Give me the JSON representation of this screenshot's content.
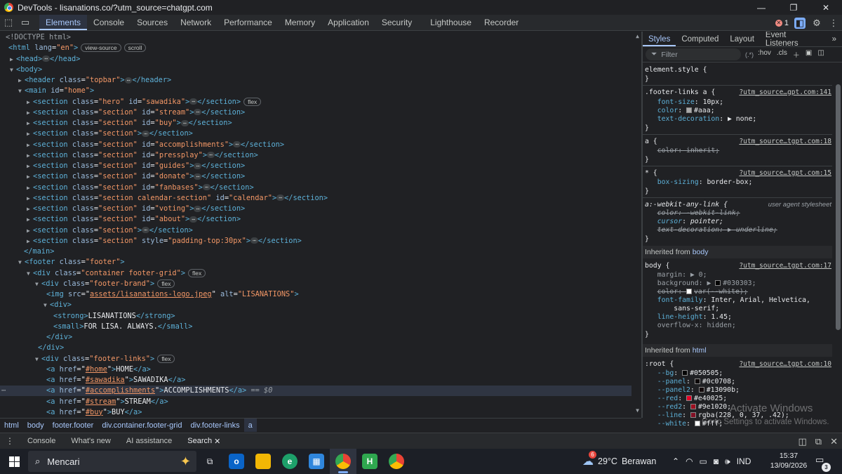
{
  "window": {
    "title": "DevTools - lisanations.co/?utm_source=chatgpt.com",
    "controls": [
      "—",
      "❐",
      "✕"
    ]
  },
  "toolbar": {
    "tabs": [
      {
        "label": "Elements",
        "active": true
      },
      {
        "label": "Console"
      },
      {
        "label": "Sources"
      },
      {
        "label": "Network"
      },
      {
        "label": "Performance"
      },
      {
        "label": "Memory"
      },
      {
        "label": "Application"
      },
      {
        "label": "Security"
      },
      {
        "label": "Lighthouse"
      },
      {
        "label": "Recorder"
      }
    ],
    "error_count": "1"
  },
  "dom": {
    "doctype": "<!DOCTYPE html>",
    "html_lang": "\"en\"",
    "view_source": "view-source",
    "scroll": "scroll",
    "flex": "flex",
    "sections": [
      {
        "cls": "\"hero\"",
        "id": "\"sawadika\"",
        "flex": true
      },
      {
        "cls": "\"section\"",
        "id": "\"stream\""
      },
      {
        "cls": "\"section\"",
        "id": "\"buy\""
      },
      {
        "cls": "\"section\"",
        "id": ""
      },
      {
        "cls": "\"section\"",
        "id": "\"accomplishments\""
      },
      {
        "cls": "\"section\"",
        "id": "\"pressplay\""
      },
      {
        "cls": "\"section\"",
        "id": "\"guides\""
      },
      {
        "cls": "\"section\"",
        "id": "\"donate\""
      },
      {
        "cls": "\"section\"",
        "id": "\"fanbases\""
      },
      {
        "cls": "\"section calendar-section\"",
        "id": "\"calendar\""
      },
      {
        "cls": "\"section\"",
        "id": "\"voting\""
      },
      {
        "cls": "\"section\"",
        "id": "\"about\""
      },
      {
        "cls": "\"section\"",
        "id": ""
      },
      {
        "cls": "\"section\"",
        "id": "",
        "style": "\"padding-top:30px\""
      }
    ],
    "header_class": "\"topbar\"",
    "main_id": "\"home\"",
    "footer_class": "\"footer\"",
    "footer_grid_class": "\"container footer-grid\"",
    "footer_brand_class": "\"footer-brand\"",
    "img_src": "assets/lisanations-logo.jpeg",
    "img_alt": "\"LISANATIONS\"",
    "strong_text": "LISANATIONS",
    "small_text": "FOR LISA. ALWAYS.",
    "footer_links_class": "\"footer-links\"",
    "links": [
      {
        "href": "#home",
        "text": "HOME"
      },
      {
        "href": "#sawadika",
        "text": "SAWADIKA"
      },
      {
        "href": "#accomplishments",
        "text": "ACCOMPLISHMENTS",
        "selected": true
      },
      {
        "href": "#stream",
        "text": "STREAM"
      },
      {
        "href": "#buy",
        "text": "BUY"
      }
    ],
    "selected_marker": "== $0"
  },
  "breadcrumbs": [
    "html",
    "body",
    "footer.footer",
    "div.container.footer-grid",
    "div.footer-links",
    "a"
  ],
  "styles": {
    "tabs": [
      {
        "label": "Styles",
        "active": true
      },
      {
        "label": "Computed"
      },
      {
        "label": "Layout"
      },
      {
        "label": "Event Listeners"
      }
    ],
    "filter_placeholder": "Filter",
    "filter_opts": [
      ":hov",
      ".cls"
    ],
    "src_a": "?utm_source…gpt.com:141",
    "src_b": "?utm_source…tgpt.com:18",
    "src_c": "?utm_source…tgpt.com:15",
    "src_d": "?utm_source…tgpt.com:17",
    "src_e": "?utm_source…tgpt.com:10",
    "ua_stylesheet": "user agent stylesheet",
    "inherited_body": "body",
    "inherited_html": "html",
    "inherited_from": "Inherited from",
    "colors": {
      "aaa": "#aaaaaa",
      "bg_030303": "#030303",
      "bg": "#050505",
      "panel": "#0c0708",
      "panel2": "#13090b",
      "red": "#e40025",
      "red2": "#9e1020",
      "line": "#e4002580",
      "white": "#ffffff"
    }
  },
  "activate": {
    "line1": "Activate Windows",
    "line2": "Go to Settings to activate Windows."
  },
  "drawer": {
    "tabs": [
      {
        "label": "Console"
      },
      {
        "label": "What's new"
      },
      {
        "label": "AI assistance"
      },
      {
        "label": "Search",
        "active": true
      }
    ]
  },
  "taskbar": {
    "search_placeholder": "Mencari",
    "weather_temp": "29°C",
    "weather_desc": "Berawan",
    "weather_badge": "6",
    "lang": "IND",
    "time": "15:37",
    "date": "13/09/2026",
    "notif_count": "3"
  }
}
